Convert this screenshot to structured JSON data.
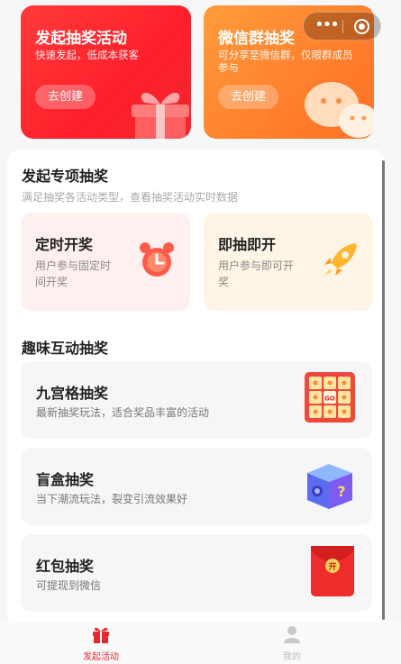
{
  "top_cards": {
    "launch": {
      "title": "发起抽奖活动",
      "subtitle": "快速发起，低成本获客",
      "button": "去创建"
    },
    "wechat": {
      "title": "微信群抽奖",
      "subtitle": "可分享至微信群，仅限群成员参与",
      "button": "去创建"
    }
  },
  "capsule": {
    "more_icon": "more-dots-icon",
    "close_icon": "target-icon"
  },
  "special_section": {
    "title": "发起专项抽奖",
    "subtitle": "满足抽奖各活动类型，查看抽奖活动实时数据",
    "cards": [
      {
        "title": "定时开奖",
        "desc": "用户参与固定时间开奖",
        "icon": "alarm-clock-icon"
      },
      {
        "title": "即抽即开",
        "desc": "用户参与即可开奖",
        "icon": "rocket-icon"
      }
    ]
  },
  "fun_section": {
    "title": "趣味互动抽奖",
    "cards": [
      {
        "title": "九宫格抽奖",
        "desc": "最新抽奖玩法，适合奖品丰富的活动",
        "icon": "nine-grid-icon",
        "grid_center": "GO"
      },
      {
        "title": "盲盒抽奖",
        "desc": "当下潮流玩法，裂变引流效果好",
        "icon": "blind-box-icon"
      },
      {
        "title": "红包抽奖",
        "desc": "可提现到微信",
        "icon": "red-envelope-icon",
        "envelope_char": "开"
      }
    ]
  },
  "tabbar": {
    "items": [
      {
        "label": "发起活动",
        "icon": "gift-icon",
        "active": true
      },
      {
        "label": "我的",
        "icon": "user-icon",
        "active": false
      }
    ]
  },
  "colors": {
    "brand_red": "#e8262d",
    "orange": "#ff7a2a"
  }
}
